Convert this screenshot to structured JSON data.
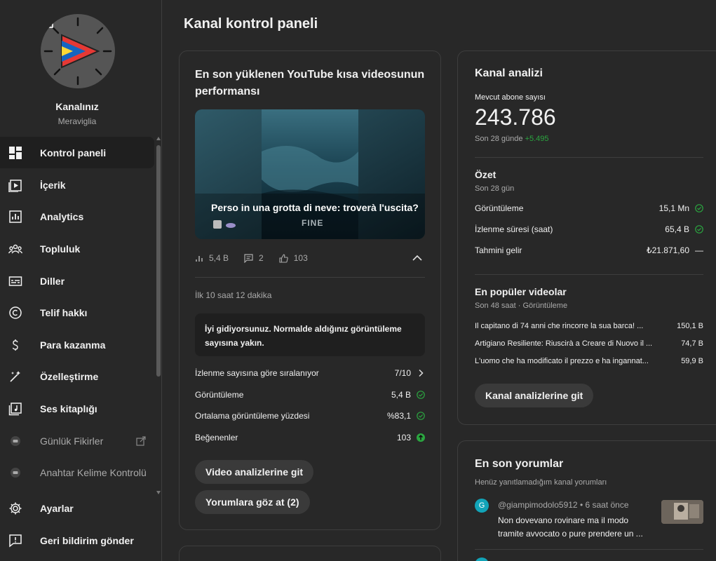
{
  "channel": {
    "name": "Kanalınız",
    "handle": "Meraviglia"
  },
  "sidebar": {
    "items": [
      {
        "label": "Kontrol paneli",
        "icon": "dashboard-icon"
      },
      {
        "label": "İçerik",
        "icon": "content-icon"
      },
      {
        "label": "Analytics",
        "icon": "analytics-icon"
      },
      {
        "label": "Topluluk",
        "icon": "community-icon"
      },
      {
        "label": "Diller",
        "icon": "subtitles-icon"
      },
      {
        "label": "Telif hakkı",
        "icon": "copyright-icon"
      },
      {
        "label": "Para kazanma",
        "icon": "dollar-icon"
      },
      {
        "label": "Özelleştirme",
        "icon": "magic-wand-icon"
      },
      {
        "label": "Ses kitaplığı",
        "icon": "audio-library-icon"
      },
      {
        "label": "Günlük Fikirler",
        "icon": "extension-icon"
      },
      {
        "label": "Anahtar Kelime Kontrolü",
        "icon": "extension-icon"
      },
      {
        "label": "Ayarlar",
        "icon": "gear-icon"
      },
      {
        "label": "Geri bildirim gönder",
        "icon": "feedback-icon"
      }
    ]
  },
  "page": {
    "title": "Kanal kontrol paneli"
  },
  "latest_short": {
    "title": "En son yüklenen YouTube kısa videosunun performansı",
    "video_title": "Perso in una grotta di neve: troverà l'uscita?",
    "video_watermark": "FINE",
    "stats": {
      "views": "5,4 B",
      "comments": "2",
      "likes": "103"
    },
    "first_period": "İlk 10 saat 12 dakika",
    "notice": "İyi gidiyorsunuz. Normalde aldığınız görüntüleme sayısına yakın.",
    "metrics": [
      {
        "label": "İzlenme sayısına göre sıralanıyor",
        "value": "7/10"
      },
      {
        "label": "Görüntüleme",
        "value": "5,4 B"
      },
      {
        "label": "Ortalama görüntüleme yüzdesi",
        "value": "%83,1"
      },
      {
        "label": "Beğenenler",
        "value": "103"
      }
    ],
    "btn_video_analytics": "Video analizlerine git",
    "btn_comments": "Yorumlara göz at (2)"
  },
  "analytics": {
    "title": "Kanal analizi",
    "subs_label": "Mevcut abone sayısı",
    "subs_value": "243.786",
    "subs_period": "Son 28 günde",
    "subs_delta": "+5.495",
    "summary_title": "Özet",
    "summary_period": "Son 28 gün",
    "summary": [
      {
        "label": "Görüntüleme",
        "value": "15,1 Mn"
      },
      {
        "label": "İzlenme süresi (saat)",
        "value": "65,4 B"
      },
      {
        "label": "Tahmini gelir",
        "value": "₺21.871,60",
        "mark": "—"
      }
    ],
    "top_title": "En popüler videolar",
    "top_period": "Son 48 saat · Görüntüleme",
    "top_videos": [
      {
        "title": "Il capitano di 74 anni che rincorre la sua barca! ...",
        "views": "150,1 B"
      },
      {
        "title": "Artigiano Resiliente: Riuscirà a Creare di Nuovo il ...",
        "views": "74,7 B"
      },
      {
        "title": "L'uomo che ha modificato il prezzo e ha ingannat...",
        "views": "59,9 B"
      }
    ],
    "btn": "Kanal analizlerine git"
  },
  "comments": {
    "title": "En son yorumlar",
    "subtitle": "Henüz yanıtlamadığım kanal yorumları",
    "items": [
      {
        "avatar_letter": "G",
        "author": "@giampimodolo5912",
        "time": "6 saat önce",
        "text": "Non dovevano rovinare ma il modo tramite avvocato o pure prendere un ..."
      }
    ]
  },
  "colors": {
    "background": "#282828",
    "accent_green": "#2ba640",
    "comment_avatar": "#12a4b8"
  }
}
